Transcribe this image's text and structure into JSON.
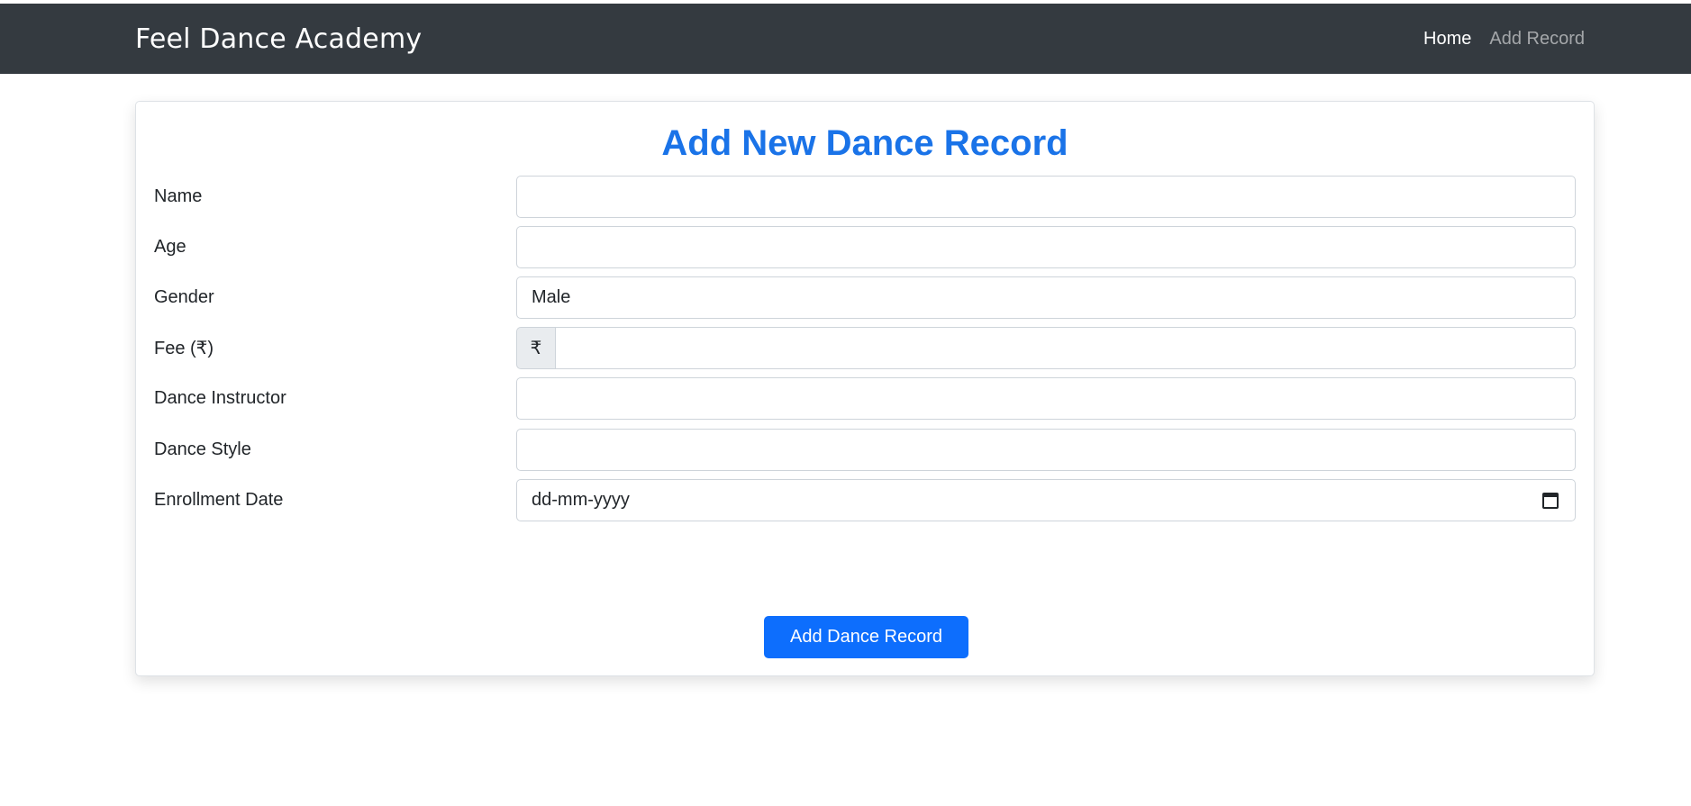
{
  "navbar": {
    "brand": "Feel Dance Academy",
    "links": [
      {
        "label": "Home"
      },
      {
        "label": "Add Record"
      }
    ]
  },
  "form": {
    "title": "Add New Dance Record",
    "fields": {
      "name": {
        "label": "Name",
        "value": ""
      },
      "age": {
        "label": "Age",
        "value": ""
      },
      "gender": {
        "label": "Gender",
        "value": "Male"
      },
      "fee": {
        "label": "Fee (₹)",
        "prefix": "₹",
        "value": ""
      },
      "instructor": {
        "label": "Dance Instructor",
        "value": ""
      },
      "style": {
        "label": "Dance Style",
        "value": ""
      },
      "enrollment": {
        "label": "Enrollment Date",
        "placeholder": "dd-mm-yyyy"
      }
    },
    "submit_label": "Add Dance Record"
  },
  "colors": {
    "navbar_bg": "#343a40",
    "title": "#1a73e8",
    "button": "#0d6efd"
  },
  "icons": {
    "date_picker": "calendar-icon"
  }
}
